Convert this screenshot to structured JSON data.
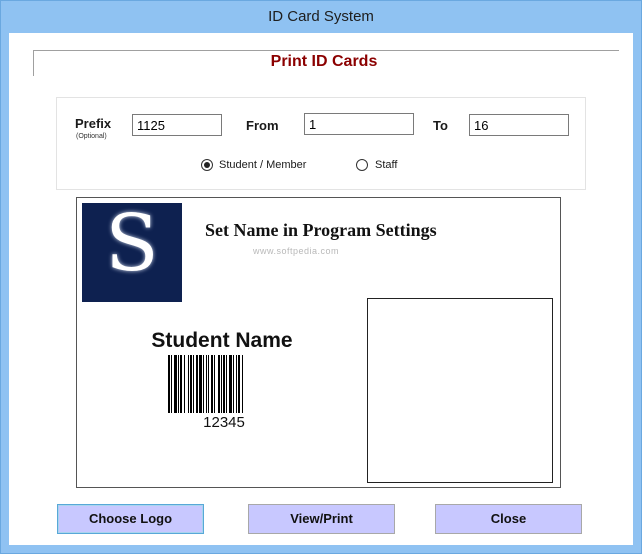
{
  "window": {
    "title": "ID Card System"
  },
  "header": {
    "title": "Print ID Cards"
  },
  "filters": {
    "prefix_label": "Prefix",
    "prefix_hint": "(Optional)",
    "prefix_value": "1125",
    "from_label": "From",
    "from_value": "1",
    "to_label": "To",
    "to_value": "16",
    "type_options": [
      {
        "label": "Student / Member",
        "checked": true
      },
      {
        "label": "Staff",
        "checked": false
      }
    ]
  },
  "card": {
    "logo_letter": "S",
    "org_name": "Set Name in Program Settings",
    "watermark": "www.softpedia.com",
    "student_name": "Student Name",
    "barcode_value": "12345",
    "logo_color": "#0e2150"
  },
  "buttons": {
    "choose_logo": "Choose Logo",
    "view_print": "View/Print",
    "close": "Close"
  },
  "colors": {
    "frame": "#8fc2f2",
    "button": "#c8c8ff",
    "header_title": "#8b0000"
  }
}
